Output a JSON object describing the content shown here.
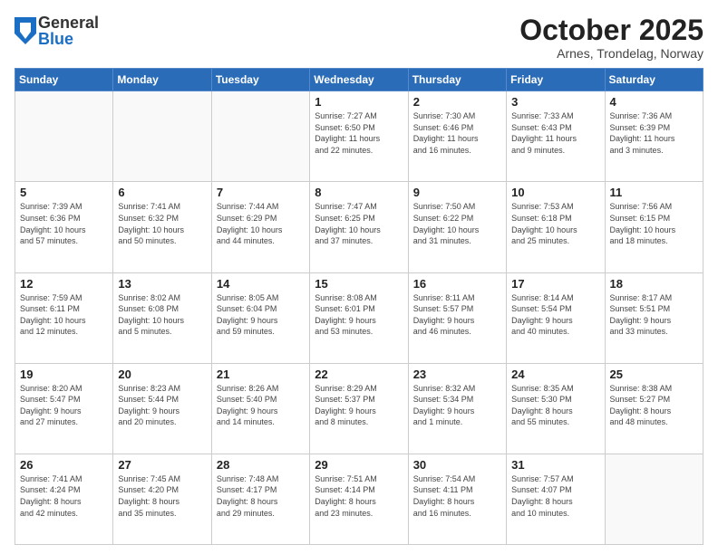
{
  "logo": {
    "general": "General",
    "blue": "Blue"
  },
  "title": "October 2025",
  "subtitle": "Arnes, Trondelag, Norway",
  "headers": [
    "Sunday",
    "Monday",
    "Tuesday",
    "Wednesday",
    "Thursday",
    "Friday",
    "Saturday"
  ],
  "weeks": [
    [
      {
        "day": "",
        "info": ""
      },
      {
        "day": "",
        "info": ""
      },
      {
        "day": "",
        "info": ""
      },
      {
        "day": "1",
        "info": "Sunrise: 7:27 AM\nSunset: 6:50 PM\nDaylight: 11 hours\nand 22 minutes."
      },
      {
        "day": "2",
        "info": "Sunrise: 7:30 AM\nSunset: 6:46 PM\nDaylight: 11 hours\nand 16 minutes."
      },
      {
        "day": "3",
        "info": "Sunrise: 7:33 AM\nSunset: 6:43 PM\nDaylight: 11 hours\nand 9 minutes."
      },
      {
        "day": "4",
        "info": "Sunrise: 7:36 AM\nSunset: 6:39 PM\nDaylight: 11 hours\nand 3 minutes."
      }
    ],
    [
      {
        "day": "5",
        "info": "Sunrise: 7:39 AM\nSunset: 6:36 PM\nDaylight: 10 hours\nand 57 minutes."
      },
      {
        "day": "6",
        "info": "Sunrise: 7:41 AM\nSunset: 6:32 PM\nDaylight: 10 hours\nand 50 minutes."
      },
      {
        "day": "7",
        "info": "Sunrise: 7:44 AM\nSunset: 6:29 PM\nDaylight: 10 hours\nand 44 minutes."
      },
      {
        "day": "8",
        "info": "Sunrise: 7:47 AM\nSunset: 6:25 PM\nDaylight: 10 hours\nand 37 minutes."
      },
      {
        "day": "9",
        "info": "Sunrise: 7:50 AM\nSunset: 6:22 PM\nDaylight: 10 hours\nand 31 minutes."
      },
      {
        "day": "10",
        "info": "Sunrise: 7:53 AM\nSunset: 6:18 PM\nDaylight: 10 hours\nand 25 minutes."
      },
      {
        "day": "11",
        "info": "Sunrise: 7:56 AM\nSunset: 6:15 PM\nDaylight: 10 hours\nand 18 minutes."
      }
    ],
    [
      {
        "day": "12",
        "info": "Sunrise: 7:59 AM\nSunset: 6:11 PM\nDaylight: 10 hours\nand 12 minutes."
      },
      {
        "day": "13",
        "info": "Sunrise: 8:02 AM\nSunset: 6:08 PM\nDaylight: 10 hours\nand 5 minutes."
      },
      {
        "day": "14",
        "info": "Sunrise: 8:05 AM\nSunset: 6:04 PM\nDaylight: 9 hours\nand 59 minutes."
      },
      {
        "day": "15",
        "info": "Sunrise: 8:08 AM\nSunset: 6:01 PM\nDaylight: 9 hours\nand 53 minutes."
      },
      {
        "day": "16",
        "info": "Sunrise: 8:11 AM\nSunset: 5:57 PM\nDaylight: 9 hours\nand 46 minutes."
      },
      {
        "day": "17",
        "info": "Sunrise: 8:14 AM\nSunset: 5:54 PM\nDaylight: 9 hours\nand 40 minutes."
      },
      {
        "day": "18",
        "info": "Sunrise: 8:17 AM\nSunset: 5:51 PM\nDaylight: 9 hours\nand 33 minutes."
      }
    ],
    [
      {
        "day": "19",
        "info": "Sunrise: 8:20 AM\nSunset: 5:47 PM\nDaylight: 9 hours\nand 27 minutes."
      },
      {
        "day": "20",
        "info": "Sunrise: 8:23 AM\nSunset: 5:44 PM\nDaylight: 9 hours\nand 20 minutes."
      },
      {
        "day": "21",
        "info": "Sunrise: 8:26 AM\nSunset: 5:40 PM\nDaylight: 9 hours\nand 14 minutes."
      },
      {
        "day": "22",
        "info": "Sunrise: 8:29 AM\nSunset: 5:37 PM\nDaylight: 9 hours\nand 8 minutes."
      },
      {
        "day": "23",
        "info": "Sunrise: 8:32 AM\nSunset: 5:34 PM\nDaylight: 9 hours\nand 1 minute."
      },
      {
        "day": "24",
        "info": "Sunrise: 8:35 AM\nSunset: 5:30 PM\nDaylight: 8 hours\nand 55 minutes."
      },
      {
        "day": "25",
        "info": "Sunrise: 8:38 AM\nSunset: 5:27 PM\nDaylight: 8 hours\nand 48 minutes."
      }
    ],
    [
      {
        "day": "26",
        "info": "Sunrise: 7:41 AM\nSunset: 4:24 PM\nDaylight: 8 hours\nand 42 minutes."
      },
      {
        "day": "27",
        "info": "Sunrise: 7:45 AM\nSunset: 4:20 PM\nDaylight: 8 hours\nand 35 minutes."
      },
      {
        "day": "28",
        "info": "Sunrise: 7:48 AM\nSunset: 4:17 PM\nDaylight: 8 hours\nand 29 minutes."
      },
      {
        "day": "29",
        "info": "Sunrise: 7:51 AM\nSunset: 4:14 PM\nDaylight: 8 hours\nand 23 minutes."
      },
      {
        "day": "30",
        "info": "Sunrise: 7:54 AM\nSunset: 4:11 PM\nDaylight: 8 hours\nand 16 minutes."
      },
      {
        "day": "31",
        "info": "Sunrise: 7:57 AM\nSunset: 4:07 PM\nDaylight: 8 hours\nand 10 minutes."
      },
      {
        "day": "",
        "info": ""
      }
    ]
  ]
}
